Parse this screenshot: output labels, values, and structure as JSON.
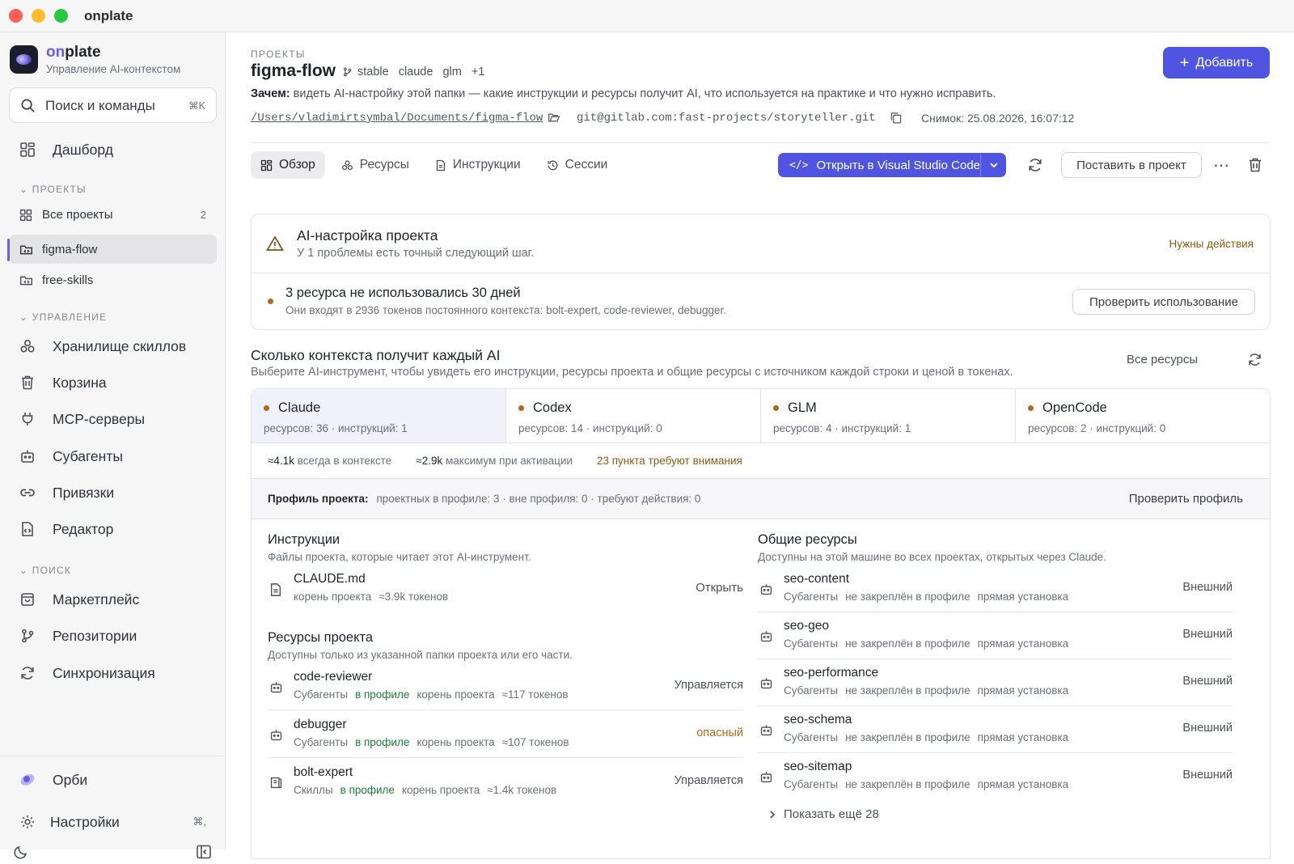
{
  "window": {
    "title": "onplate"
  },
  "sidebar": {
    "brand_on": "on",
    "brand_rest": "plate",
    "brand_sub": "Управление AI-контекстом",
    "search_placeholder": "Поиск и команды",
    "search_shortcut": "⌘K",
    "dashboard": "Дашборд",
    "projects_section": "ПРОЕКТЫ",
    "projects": [
      {
        "label": "Все проекты",
        "count": "2"
      },
      {
        "label": "figma-flow"
      },
      {
        "label": "free-skills"
      }
    ],
    "manage_section": "УПРАВЛЕНИЕ",
    "manage": [
      "Хранилище скиллов",
      "Корзина",
      "MCP-серверы",
      "Субагенты",
      "Привязки",
      "Редактор"
    ],
    "search_section": "ПОИСК",
    "search_items": [
      "Маркетплейс",
      "Репозитории",
      "Синхронизация"
    ],
    "orbi": "Орби",
    "settings": "Настройки",
    "settings_shortcut": "⌘,"
  },
  "header": {
    "eyebrow": "ПРОЕКТЫ",
    "title": "figma-flow",
    "tags": [
      "stable",
      "claude",
      "glm",
      "+1"
    ],
    "why_label": "Зачем:",
    "why_text": "видеть AI-настройку этой папки — какие инструкции и ресурсы получит AI, что используется на практике и что нужно исправить.",
    "path": "/Users/vladimirtsymbal/Documents/figma-flow",
    "git": "git@gitlab.com:fast-projects/storyteller.git",
    "snapshot": "Снимок: 25.08.2026, 16:07:12",
    "add_button": "Добавить"
  },
  "tabs": [
    "Обзор",
    "Ресурсы",
    "Инструкции",
    "Сессии"
  ],
  "toolbar": {
    "open_vscode": "Открыть в Visual Studio Code",
    "put_in_project": "Поставить в проект"
  },
  "setup_card": {
    "title": "AI-настройка проекта",
    "subtitle": "У 1 проблемы есть точный следующий шаг.",
    "status": "Нужны действия",
    "issue_title": "3 ресурса не использовались 30 дней",
    "issue_text": "Они входят в 2936 токенов постоянного контекста: bolt-expert, code-reviewer, debugger.",
    "issue_action": "Проверить использование"
  },
  "context": {
    "title": "Сколько контекста получит каждый AI",
    "subtitle": "Выберите AI-инструмент, чтобы увидеть его инструкции, ресурсы проекта и общие ресурсы с источником каждой строки и ценой в токенах.",
    "all_resources": "Все ресурсы",
    "tools": [
      {
        "name": "Claude",
        "meta": "ресурсов: 36 · инструкций: 1"
      },
      {
        "name": "Codex",
        "meta": "ресурсов: 14 · инструкций: 0"
      },
      {
        "name": "GLM",
        "meta": "ресурсов: 4 · инструкций: 1"
      },
      {
        "name": "OpenCode",
        "meta": "ресурсов: 2 · инструкций: 0"
      }
    ],
    "stat1_value": "≈4.1k",
    "stat1_label": "всегда в контексте",
    "stat2_value": "≈2.9k",
    "stat2_label": "максимум при активации",
    "stat3": "23 пункта требуют внимания",
    "profile_label": "Профиль проекта:",
    "profile_text": "проектных в профиле: 3 · вне профиля: 0 · требуют действия: 0",
    "profile_action": "Проверить профиль"
  },
  "instructions": {
    "title": "Инструкции",
    "subtitle": "Файлы проекта, которые читает этот AI-инструмент.",
    "items": [
      {
        "name": "CLAUDE.md",
        "meta": [
          "корень проекта",
          "≈3.9k токенов"
        ],
        "action": "Открыть"
      }
    ]
  },
  "project_resources": {
    "title": "Ресурсы проекта",
    "subtitle": "Доступны только из указанной папки проекта или его части.",
    "items": [
      {
        "name": "code-reviewer",
        "type": "Субагенты",
        "profile": "в профиле",
        "loc": "корень проекта",
        "tokens": "≈117 токенов",
        "status": "Управляется"
      },
      {
        "name": "debugger",
        "type": "Субагенты",
        "profile": "в профиле",
        "loc": "корень проекта",
        "tokens": "≈107 токенов",
        "status": "опасный"
      },
      {
        "name": "bolt-expert",
        "type": "Скиллы",
        "profile": "в профиле",
        "loc": "корень проекта",
        "tokens": "≈1.4k токенов",
        "status": "Управляется"
      }
    ]
  },
  "shared_resources": {
    "title": "Общие ресурсы",
    "subtitle": "Доступны на этой машине во всех проектах, открытых через Claude.",
    "items": [
      {
        "name": "seo-content",
        "type": "Субагенты",
        "profile": "не закреплён в профиле",
        "install": "прямая установка",
        "status": "Внешний"
      },
      {
        "name": "seo-geo",
        "type": "Субагенты",
        "profile": "не закреплён в профиле",
        "install": "прямая установка",
        "status": "Внешний"
      },
      {
        "name": "seo-performance",
        "type": "Субагенты",
        "profile": "не закреплён в профиле",
        "install": "прямая установка",
        "status": "Внешний"
      },
      {
        "name": "seo-schema",
        "type": "Субагенты",
        "profile": "не закреплён в профиле",
        "install": "прямая установка",
        "status": "Внешний"
      },
      {
        "name": "seo-sitemap",
        "type": "Субагенты",
        "profile": "не закреплён в профиле",
        "install": "прямая установка",
        "status": "Внешний"
      }
    ],
    "show_more": "Показать ещё 28"
  },
  "colors": {
    "accent": "#4f55e0",
    "brand": "#6c5ce7",
    "warning": "#8a5a14",
    "ok": "#1f7a3a"
  }
}
